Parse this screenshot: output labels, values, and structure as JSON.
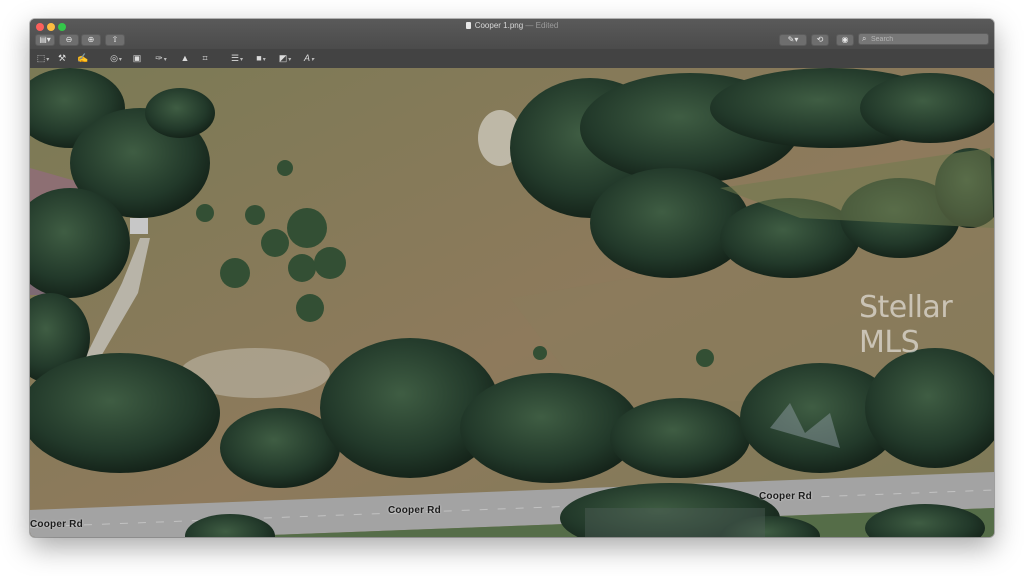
{
  "window": {
    "title": "Cooper 1.png",
    "title_suffix": "— Edited",
    "doc_icon": "document-icon"
  },
  "toolbar": {
    "left_icons": [
      "sidebar-icon",
      "zoom-out-icon",
      "zoom-in-icon",
      "share-icon"
    ],
    "right_icons": [
      "markup-pen-icon",
      "rotate-icon",
      "annotate-icon"
    ],
    "search_placeholder": "Search"
  },
  "markup_tools": [
    "rect-select-icon",
    "instant-alpha-icon",
    "sketch-icon",
    "shapes-icon",
    "text-icon",
    "sign-icon",
    "adjust-color-icon",
    "line-style-icon",
    "border-color-icon",
    "fill-color-icon",
    "text-style-icon"
  ],
  "image": {
    "road_labels": [
      "Cooper Rd",
      "Cooper Rd",
      "Cooper Rd"
    ],
    "watermark": "Stellar MLS"
  },
  "colors": {
    "titlebar": "#4f4f4f",
    "road": "#9c9c9c",
    "canopy": "#1f3a25",
    "field": "#8b7a55"
  }
}
